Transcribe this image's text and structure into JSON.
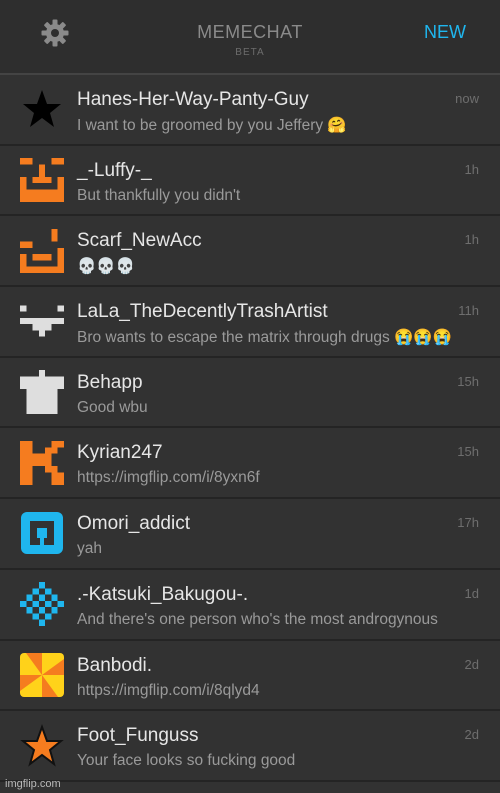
{
  "header": {
    "title": "MEMECHAT",
    "subtitle": "BETA",
    "new_label": "NEW",
    "settings_icon": "gear-icon",
    "accent_color": "#1fb6ee"
  },
  "chats": [
    {
      "name": "Hanes-Her-Way-Panty-Guy",
      "message": "I want to be groomed by you Jeffery 🤗",
      "time": "now",
      "avatar": "black-star"
    },
    {
      "name": "_-Luffy-_",
      "message": "But thankfully you didn't",
      "time": "1h",
      "avatar": "orange-pixel-face"
    },
    {
      "name": "Scarf_NewAcc",
      "message": "💀💀💀",
      "time": "1h",
      "avatar": "orange-pixel-face-alt"
    },
    {
      "name": "LaLa_TheDecentlyTrashArtist",
      "message": "Bro wants to escape the matrix through drugs 😭😭😭",
      "time": "11h",
      "avatar": "white-pixel-face"
    },
    {
      "name": "Behapp",
      "message": "Good wbu",
      "time": "15h",
      "avatar": "white-shirt"
    },
    {
      "name": "Kyrian247",
      "message": "https://imgflip.com/i/8yxn6f",
      "time": "15h",
      "avatar": "orange-pixel-k"
    },
    {
      "name": "Omori_addict",
      "message": "yah",
      "time": "17h",
      "avatar": "blue-square-ring"
    },
    {
      "name": ".-Katsuki_Bakugou-.",
      "message": "And there's one person who's the most androgynous",
      "time": "1d",
      "avatar": "blue-checker"
    },
    {
      "name": "Banbodi.",
      "message": "https://imgflip.com/i/8qlyd4",
      "time": "2d",
      "avatar": "pinwheel"
    },
    {
      "name": "Foot_Funguss",
      "message": "Your face looks so fucking good",
      "time": "2d",
      "avatar": "orange-star"
    }
  ],
  "watermark": "imgflip.com"
}
